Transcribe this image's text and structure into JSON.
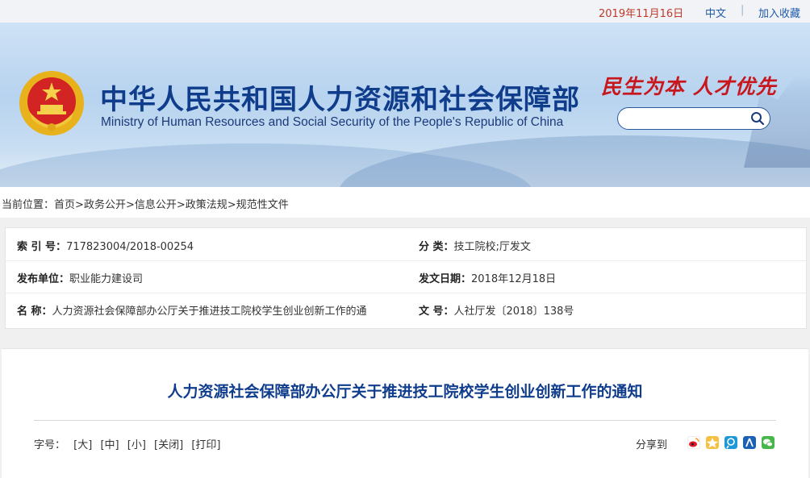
{
  "topbar": {
    "date": "2019年11月16日",
    "lang": "中文",
    "separator": "|",
    "favorite": "加入收藏"
  },
  "header": {
    "title_cn": "中华人民共和国人力资源和社会保障部",
    "title_en": "Ministry of Human Resources and Social Security of the People's Republic of China",
    "slogan": "民生为本 人才优先",
    "search_placeholder": ""
  },
  "breadcrumb": {
    "prefix": "当前位置：",
    "items": [
      "首页",
      "政务公开",
      "信息公开",
      "政策法规",
      "规范性文件"
    ],
    "sep": ">"
  },
  "meta": {
    "index_label": "索 引 号：",
    "index_value": "717823004/2018-00254",
    "category_label": "分 类：",
    "category_value": "技工院校;厅发文",
    "issuer_label": "发布单位：",
    "issuer_value": "职业能力建设司",
    "date_label": "发文日期：",
    "date_value": "2018年12月18日",
    "name_label": "名 称：",
    "name_value": "人力资源社会保障部办公厅关于推进技工院校学生创业创新工作的通",
    "doc_label": "文 号：",
    "doc_value": "人社厅发〔2018〕138号"
  },
  "article": {
    "title": "人力资源社会保障部办公厅关于推进技工院校学生创业创新工作的通知",
    "font_label": "字号：",
    "font_large": "[大]",
    "font_medium": "[中]",
    "font_small": "[小]",
    "close": "[关闭]",
    "print": "[打印]",
    "share_label": "分享到"
  },
  "colors": {
    "title_blue": "#0f3d8c",
    "slogan_red": "#c8161d",
    "date_red": "#c0392b",
    "link_blue": "#1e5aa8"
  },
  "share_icons": [
    "weibo-icon",
    "qzone-icon",
    "tencent-weibo-icon",
    "renren-icon",
    "wechat-icon"
  ]
}
